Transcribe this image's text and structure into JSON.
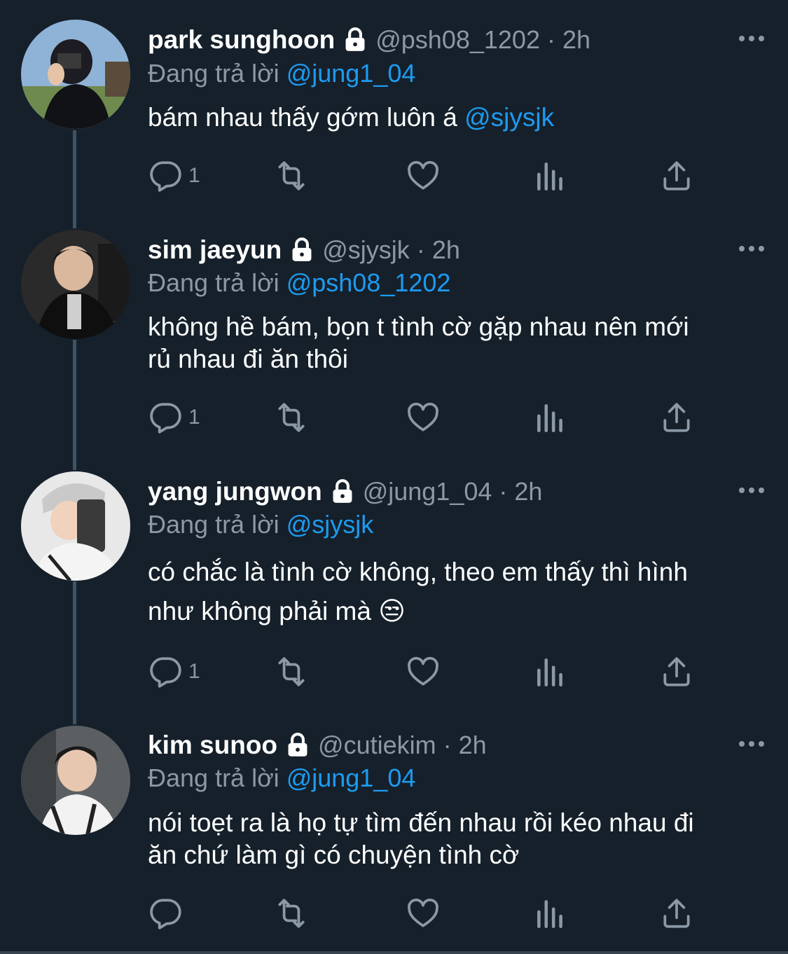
{
  "reply_prefix": "Đang trả lời",
  "icons": {
    "lock": "lock-icon",
    "more": "more-icon",
    "reply": "reply-icon",
    "retweet": "retweet-icon",
    "like": "heart-icon",
    "views": "views-icon",
    "share": "share-icon"
  },
  "colors": {
    "background": "#15202b",
    "muted": "#8b98a5",
    "accent": "#1d9bf0",
    "thread_line": "#3d5466"
  },
  "tweets": [
    {
      "name": "park sunghoon",
      "handle": "@psh08_1202",
      "time": "2h",
      "reply_to": "@jung1_04",
      "text_lines": [
        "bám nhau thấy gớm luôn á "
      ],
      "text_mention": "@sjysjk",
      "reply_count": "1"
    },
    {
      "name": "sim jaeyun",
      "handle": "@sjysjk",
      "time": "2h",
      "reply_to": "@psh08_1202",
      "text_lines": [
        "không hề bám, bọn t tình cờ gặp nhau nên mới",
        "rủ nhau đi ăn thôi"
      ],
      "reply_count": "1"
    },
    {
      "name": "yang jungwon",
      "handle": "@jung1_04",
      "time": "2h",
      "reply_to": "@sjysjk",
      "text_lines": [
        "có chắc là tình cờ không, theo em thấy thì hình",
        "như không phải mà 😒"
      ],
      "reply_count": "1"
    },
    {
      "name": "kim sunoo",
      "handle": "@cutiekim",
      "time": "2h",
      "reply_to": "@jung1_04",
      "text_lines": [
        "nói toẹt ra là họ tự tìm đến nhau rồi kéo nhau đi",
        "ăn chứ làm gì có chuyện tình cờ"
      ],
      "reply_count": ""
    }
  ]
}
